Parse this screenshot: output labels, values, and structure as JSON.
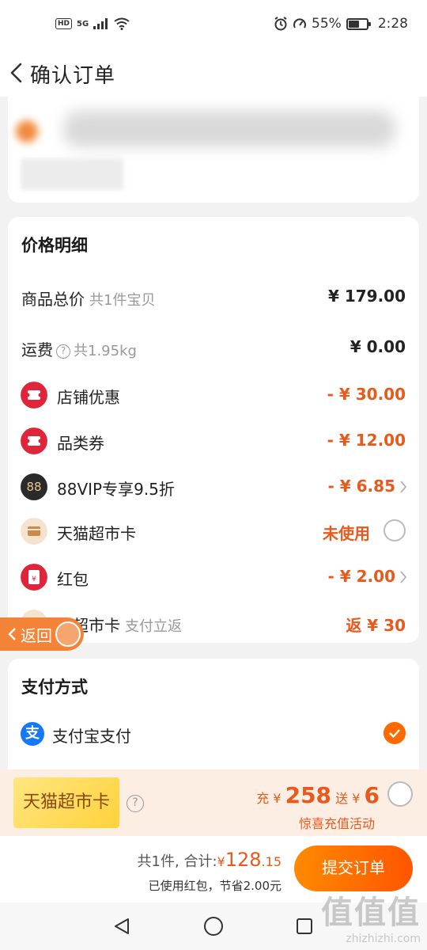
{
  "status_bar": {
    "hd": "HD",
    "network": "5G",
    "battery": "55%",
    "battery_level": 0.55,
    "time": "2:28"
  },
  "nav": {
    "title": "确认订单"
  },
  "price_detail": {
    "title": "价格明细",
    "rows": [
      {
        "label": "商品总价",
        "sub": "共1件宝贝",
        "value": "¥ 179.00"
      },
      {
        "label": "运费",
        "sub": "共1.95kg",
        "value": "¥ 0.00"
      },
      {
        "label": "店铺优惠",
        "value": "- ¥ 30.00"
      },
      {
        "label": "品类券",
        "value": "- ¥ 12.00"
      },
      {
        "label": "88VIP专享9.5折",
        "icon_text": "88",
        "value": "- ¥ 6.85"
      },
      {
        "label": "天猫超市卡",
        "value": "未使用"
      },
      {
        "label": "红包",
        "value": "- ¥ 2.00"
      },
      {
        "label": "返超市卡",
        "sub": "支付立返",
        "value": "返 ¥ 30"
      }
    ]
  },
  "float_back": {
    "label": "返回"
  },
  "payment": {
    "title": "支付方式",
    "method": "支付宝支付",
    "icon_char": "支"
  },
  "promo": {
    "card_label": "天猫超市卡",
    "q_mark": "?",
    "charge_prefix": "充 ¥",
    "charge_amount": "258",
    "gift_prefix": "送 ¥",
    "gift_amount": "6",
    "subtitle": "惊喜充值活动"
  },
  "bottom": {
    "count": "共1件,",
    "total_label": "合计:",
    "currency": "¥",
    "total_int": "128",
    "total_dec": ".15",
    "saved_text": "已使用红包，节省2.00元",
    "submit_label": "提交订单"
  },
  "watermark": {
    "big": "值值值",
    "small": "zhizhizhi.com"
  },
  "colors": {
    "accent": "#ff6a00",
    "price_orange": "#e8591b",
    "alipay_blue": "#1677ff"
  }
}
